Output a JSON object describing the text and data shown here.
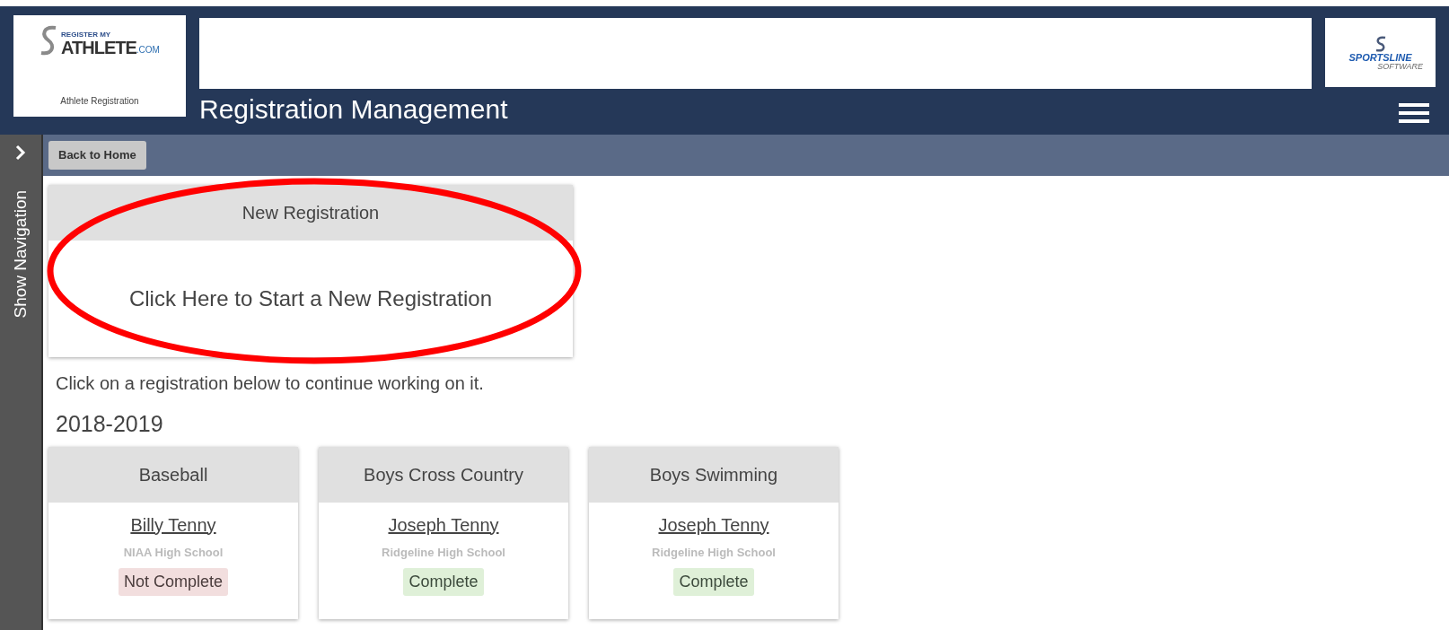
{
  "header": {
    "logo": {
      "line_1": "REGISTER MY",
      "line_2": "ATHLETE",
      "line_3": ".COM",
      "caption": "Athlete Registration"
    },
    "title": "Registration Management",
    "partner_logo": {
      "line_1": "SPORTSLINE",
      "line_2": "SOFTWARE"
    }
  },
  "sidebar": {
    "label": "Show Navigation",
    "expanded": false
  },
  "toolbar": {
    "back_button": "Back to Home"
  },
  "new_registration": {
    "title": "New Registration",
    "action": "Click Here to Start a New Registration"
  },
  "instructions": "Click on a registration below to continue working on it.",
  "season": "2018-2019",
  "registrations": [
    {
      "sport": "Baseball",
      "athlete": "Billy Tenny",
      "school": "NIAA High School",
      "status": "Not Complete",
      "kind": "incomplete"
    },
    {
      "sport": "Boys Cross Country",
      "athlete": "Joseph Tenny",
      "school": "Ridgeline High School",
      "status": "Complete",
      "kind": "complete"
    },
    {
      "sport": "Boys Swimming",
      "athlete": "Joseph Tenny",
      "school": "Ridgeline High School",
      "status": "Complete",
      "kind": "complete"
    }
  ]
}
